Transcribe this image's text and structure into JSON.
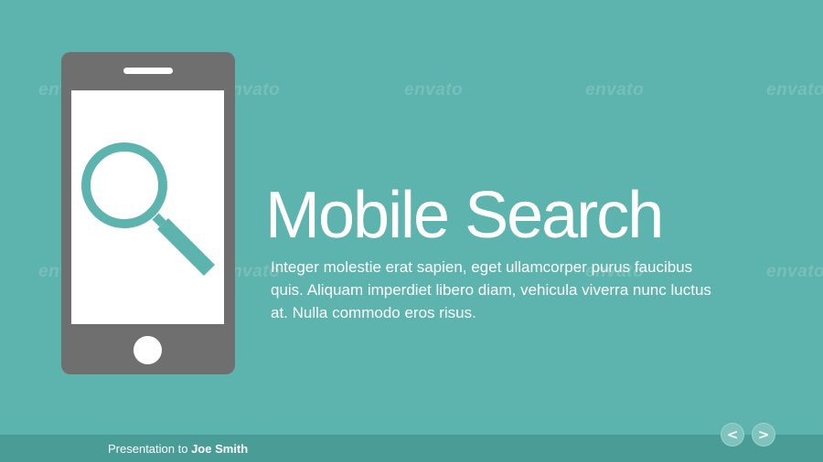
{
  "slide": {
    "title": "Mobile Search",
    "body": "Integer molestie erat sapien, eget ullamcorper purus faucibus quis. Aliquam imperdiet libero diam, vehicula viverra nunc luctus at. Nulla commodo eros risus.",
    "illustration_icon": "search-icon"
  },
  "footer": {
    "prefix": "Presentation to",
    "name": "Joe Smith"
  },
  "nav": {
    "prev_label": "<",
    "next_label": ">"
  },
  "watermark": {
    "text": "envato"
  },
  "colors": {
    "background": "#5db3ad",
    "footer_bar": "#4a9c97",
    "phone_body": "#6f6f6f",
    "search_icon": "#5db3ad",
    "text": "#ffffff",
    "nav_button": "#7ec3be"
  }
}
